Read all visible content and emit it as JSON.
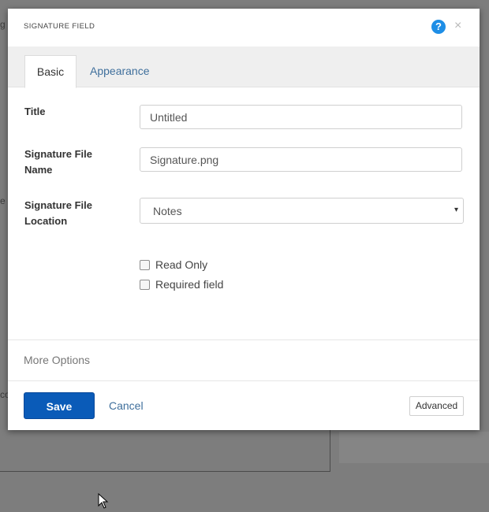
{
  "background": {
    "fragments": [
      "g",
      "e",
      "co"
    ]
  },
  "dialog": {
    "title": "SIGNATURE FIELD",
    "help_icon": "question-circle-icon",
    "help_glyph": "?",
    "close_icon": "close-icon",
    "close_glyph": "×"
  },
  "tabs": [
    {
      "label": "Basic",
      "active": true
    },
    {
      "label": "Appearance",
      "active": false
    }
  ],
  "form": {
    "title_label": "Title",
    "title_value": "Untitled",
    "file_name_label_line1": "Signature File",
    "file_name_label_line2": "Name",
    "file_name_value": "Signature.png",
    "file_location_label_line1": "Signature File",
    "file_location_label_line2": "Location",
    "file_location_value": "Notes",
    "file_location_arrow": "▾",
    "read_only_label": "Read Only",
    "read_only_checked": false,
    "required_label": "Required field",
    "required_checked": false
  },
  "more_options": "More Options",
  "footer": {
    "save_label": "Save",
    "cancel_label": "Cancel",
    "advanced_label": "Advanced"
  },
  "colors": {
    "accent": "#0a5bb8",
    "link": "#3f6f9c",
    "help_icon": "#1e8ee6",
    "overlay": "#7d7d7d"
  }
}
